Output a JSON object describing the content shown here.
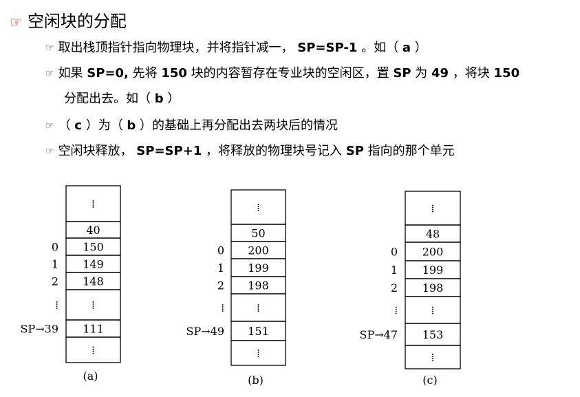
{
  "heading": {
    "icon": "pointing-hand-icon",
    "text": "空闲块的分配"
  },
  "bullets": [
    {
      "icon": "pointing-hand-icon",
      "parts": [
        {
          "t": "取出栈顶指针指向物理块，并将指针减一，  ",
          "b": false
        },
        {
          "t": "SP=SP-1",
          "b": true
        },
        {
          "t": " 。如（ ",
          "b": false
        },
        {
          "t": "a",
          "b": true
        },
        {
          "t": " ）",
          "b": false
        }
      ]
    },
    {
      "icon": "pointing-hand-icon",
      "parts": [
        {
          "t": "如果 ",
          "b": false
        },
        {
          "t": "SP=0,",
          "b": true
        },
        {
          "t": " 先将 ",
          "b": false
        },
        {
          "t": "150",
          "b": true
        },
        {
          "t": " 块的内容暂存在专业块的空闲区，置 ",
          "b": false
        },
        {
          "t": "SP",
          "b": true
        },
        {
          "t": " 为 ",
          "b": false
        },
        {
          "t": "49",
          "b": true
        },
        {
          "t": " ，将块 ",
          "b": false
        },
        {
          "t": "150",
          "b": true
        }
      ],
      "continuation": [
        {
          "t": "分配出去。如（ ",
          "b": false
        },
        {
          "t": "b",
          "b": true
        },
        {
          "t": " ）",
          "b": false
        }
      ]
    },
    {
      "icon": "pointing-hand-icon",
      "parts": [
        {
          "t": "（ ",
          "b": false
        },
        {
          "t": "c",
          "b": true
        },
        {
          "t": " ）为（ ",
          "b": false
        },
        {
          "t": "b",
          "b": true
        },
        {
          "t": " ）的基础上再分配出去两块后的情况",
          "b": false
        }
      ]
    },
    {
      "icon": "pointing-hand-icon",
      "parts": [
        {
          "t": "空闲块释放，  ",
          "b": false
        },
        {
          "t": "SP=SP+1",
          "b": true
        },
        {
          "t": " ，将释放的物理块号记入 ",
          "b": false
        },
        {
          "t": "SP",
          "b": true
        },
        {
          "t": " 指向的那个单元",
          "b": false
        }
      ]
    }
  ],
  "stacks": [
    {
      "caption": "(a)",
      "cells": [
        "⁞",
        "40",
        "150",
        "149",
        "148",
        "⁞",
        "111",
        "⁞"
      ],
      "indices": [
        "",
        "",
        "0",
        "1",
        "2",
        "⁞",
        "SP→39",
        ""
      ]
    },
    {
      "caption": "(b)",
      "cells": [
        "⁞",
        "50",
        "200",
        "199",
        "198",
        "⁞",
        "151",
        "⁞"
      ],
      "indices": [
        "",
        "",
        "0",
        "1",
        "2",
        "⁞",
        "SP→49",
        ""
      ]
    },
    {
      "caption": "(c)",
      "cells": [
        "⁞",
        "48",
        "200",
        "199",
        "198",
        "⁞",
        "153",
        "⁞"
      ],
      "indices": [
        "",
        "",
        "0",
        "1",
        "2",
        "⁞",
        "SP→47",
        ""
      ]
    }
  ]
}
